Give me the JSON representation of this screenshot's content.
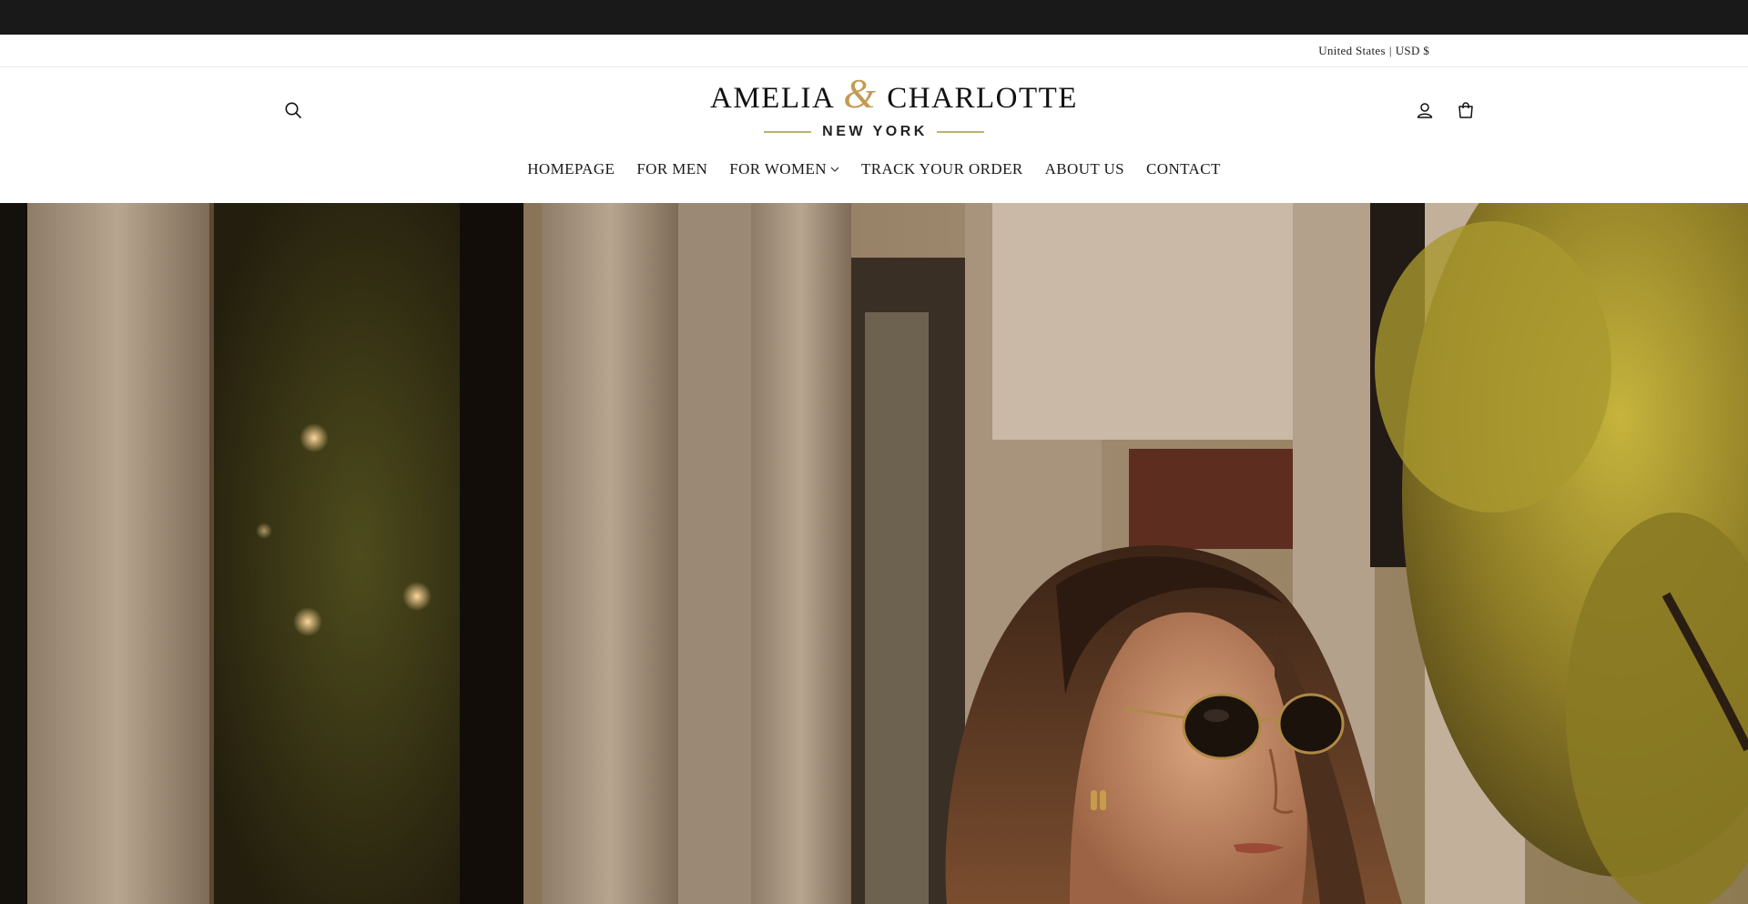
{
  "locale": {
    "country": "United States",
    "separator": "|",
    "currency": "USD $"
  },
  "header": {
    "icons": {
      "search": "search-icon",
      "account": "account-icon",
      "cart": "cart-icon"
    },
    "logo": {
      "word_left": "AMELIA",
      "ampersand": "&",
      "word_right": "CHARLOTTE",
      "tagline": "NEW YORK"
    },
    "nav": [
      {
        "label": "HOMEPAGE"
      },
      {
        "label": "FOR MEN"
      },
      {
        "label": "FOR WOMEN",
        "has_dropdown": true
      },
      {
        "label": "TRACK YOUR ORDER"
      },
      {
        "label": "ABOUT US"
      },
      {
        "label": "CONTACT"
      }
    ]
  },
  "colors": {
    "announcement_bar": "#19191a",
    "logo_accent": "#c39a54",
    "logo_rule": "#b9b274"
  }
}
